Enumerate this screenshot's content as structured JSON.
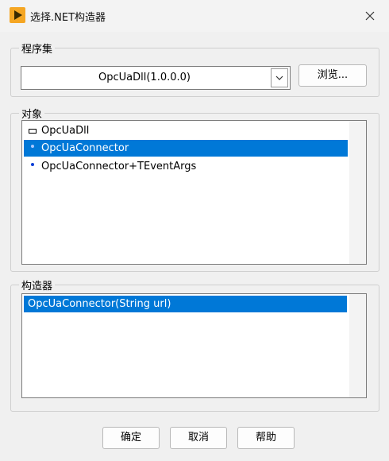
{
  "window": {
    "title": "选择.NET构造器"
  },
  "assembly": {
    "label": "程序集",
    "selected": "OpcUaDll(1.0.0.0)",
    "browse_label": "浏览..."
  },
  "objects": {
    "label": "对象",
    "items": [
      {
        "label": "OpcUaDll",
        "icon": "class-icon"
      },
      {
        "label": "OpcUaConnector",
        "icon": "object-icon",
        "selected": true
      },
      {
        "label": "OpcUaConnector+TEventArgs",
        "icon": "object-icon"
      }
    ]
  },
  "constructors": {
    "label": "构造器",
    "items": [
      {
        "label": "OpcUaConnector(String url)",
        "selected": true
      }
    ]
  },
  "footer": {
    "ok_label": "确定",
    "cancel_label": "取消",
    "help_label": "帮助"
  },
  "colors": {
    "selection": "#0078d7",
    "icon_bg": "#f5a623"
  }
}
